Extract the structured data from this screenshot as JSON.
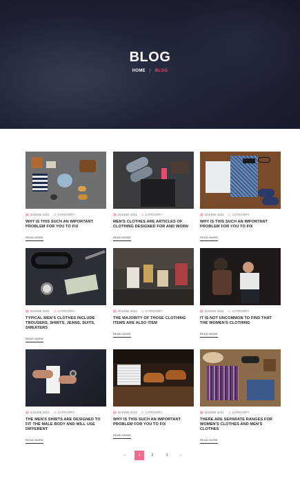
{
  "hero": {
    "title": "BLOG",
    "breadcrumb": {
      "home": "HOME",
      "separator": "|",
      "current": "BLOG"
    }
  },
  "posts": [
    {
      "date": "20JUNE 2021",
      "category": "CATEGORY",
      "title": "WHY IS THIS SUCH AN IMPORTANT PROBLEM FOR YOU TO FIX",
      "read_more": "READ MORE"
    },
    {
      "date": "20JUNE 2021",
      "category": "CATEGORY",
      "title": "MEN'S CLOTHES ARE ARTICLES OF CLOTHING DESIGNED FOR AND WORN",
      "read_more": "READ MORE"
    },
    {
      "date": "20JUNE 2021",
      "category": "CATEGORY",
      "title": "WHY IS THIS SUCH AN IMPORTANT PROBLEM FOR YOU TO FIX",
      "read_more": "READ MORE"
    },
    {
      "date": "20JUNE 2021",
      "category": "CATEGORY",
      "title": "TYPICAL MEN'S CLOTHES INCLUDE TROUSERS, SHIRTS, JEANS, SUITS, SWEATERS",
      "read_more": "READ MORE"
    },
    {
      "date": "20JUNE 2021",
      "category": "CATEGORY",
      "title": "THE MAJORITY OF THOSE CLOTHING ITEMS ARE ALSO ITEM",
      "read_more": "READ MORE"
    },
    {
      "date": "20JUNE 2021",
      "category": "CATEGORY",
      "title": "IT IS NOT UNCOMMON TO FIND THAT THE WOMEN'S CLOTHING",
      "read_more": "READ MORE"
    },
    {
      "date": "20JUNE 2021",
      "category": "CATEGORY",
      "title": "THE MEN'S SHIRTS ARE DESIGNED TO FIT THE MALE BODY AND WILL USE DIFFERENT",
      "read_more": "READ MORE"
    },
    {
      "date": "20JUNE 2021",
      "category": "CATEGORY",
      "title": "WHY IS THIS SUCH AN IMPORTANT PROBLEM FOR YOU TO FIX",
      "read_more": "READ MORE"
    },
    {
      "date": "20JUNE 2021",
      "category": "CATEGORY",
      "title": "THERE ARE SEPARATE RANGES FOR WOMEN'S CLOTHES AND MEN'S CLOTHES",
      "read_more": "READ MORE"
    }
  ],
  "pagination": {
    "prev": "‹",
    "pages": [
      "1",
      "2",
      "3"
    ],
    "next": "›",
    "active": "1"
  },
  "colors": {
    "accent": "#e84a72",
    "hero_bg": "#1f2335",
    "active_page": "#ef6b8f"
  },
  "icons": {
    "date": "calendar-icon",
    "category": "tag-icon"
  }
}
